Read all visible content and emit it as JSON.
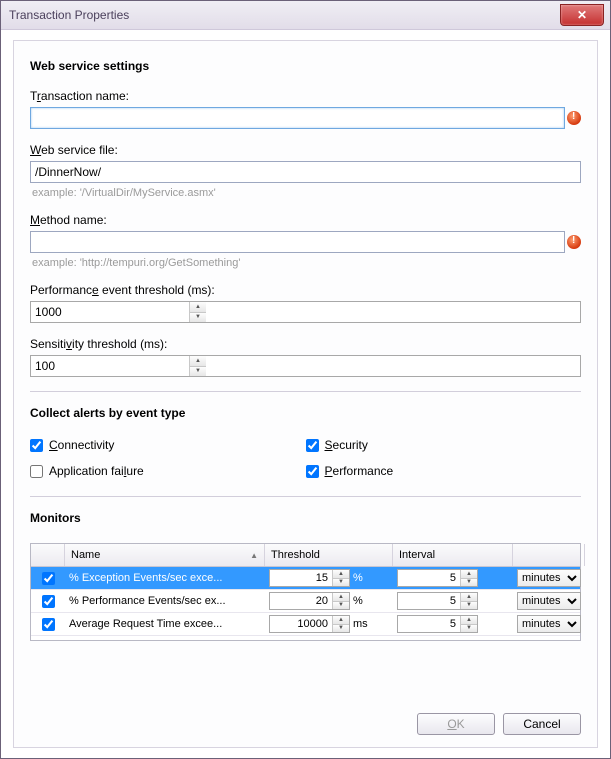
{
  "window": {
    "title": "Transaction Properties"
  },
  "headings": {
    "web_service_settings": "Web service settings",
    "collect_alerts": "Collect alerts by event type",
    "monitors": "Monitors"
  },
  "labels": {
    "transaction_name_pre": "T",
    "transaction_name_mn": "r",
    "transaction_name_post": "ansaction name:",
    "web_service_file_mn": "W",
    "web_service_file_post": "eb service file:",
    "method_name_mn": "M",
    "method_name_post": "ethod name:",
    "perf_threshold_pre": "Performanc",
    "perf_threshold_mn": "e",
    "perf_threshold_post": " event threshold (ms):",
    "sens_threshold_pre": "Sensiti",
    "sens_threshold_mn": "v",
    "sens_threshold_post": "ity threshold (ms):"
  },
  "fields": {
    "transaction_name": "",
    "web_service_file": "/DinnerNow/",
    "web_service_file_hint": "example: '/VirtualDir/MyService.asmx'",
    "method_name": "",
    "method_name_hint": "example: 'http://tempuri.org/GetSomething'",
    "performance_threshold": "1000",
    "sensitivity_threshold": "100"
  },
  "alerts": {
    "connectivity_mn": "C",
    "connectivity_post": "onnectivity",
    "connectivity_checked": true,
    "security_mn": "S",
    "security_post": "ecurity",
    "security_checked": true,
    "appfail_pre": "Application fai",
    "appfail_mn": "l",
    "appfail_post": "ure",
    "appfail_checked": false,
    "performance_mn": "P",
    "performance_post": "erformance",
    "performance_checked": true
  },
  "monitors_table": {
    "columns": {
      "name": "Name",
      "threshold": "Threshold",
      "interval": "Interval"
    },
    "interval_unit": "minutes",
    "rows": [
      {
        "checked": true,
        "selected": true,
        "name": "% Exception Events/sec exce...",
        "threshold": "15",
        "unit": "%",
        "interval": "5"
      },
      {
        "checked": true,
        "selected": false,
        "name": "% Performance Events/sec ex...",
        "threshold": "20",
        "unit": "%",
        "interval": "5"
      },
      {
        "checked": true,
        "selected": false,
        "name": "Average Request Time excee...",
        "threshold": "10000",
        "unit": "ms",
        "interval": "5"
      }
    ]
  },
  "buttons": {
    "ok_mn": "O",
    "ok_post": "K",
    "cancel": "Cancel"
  }
}
